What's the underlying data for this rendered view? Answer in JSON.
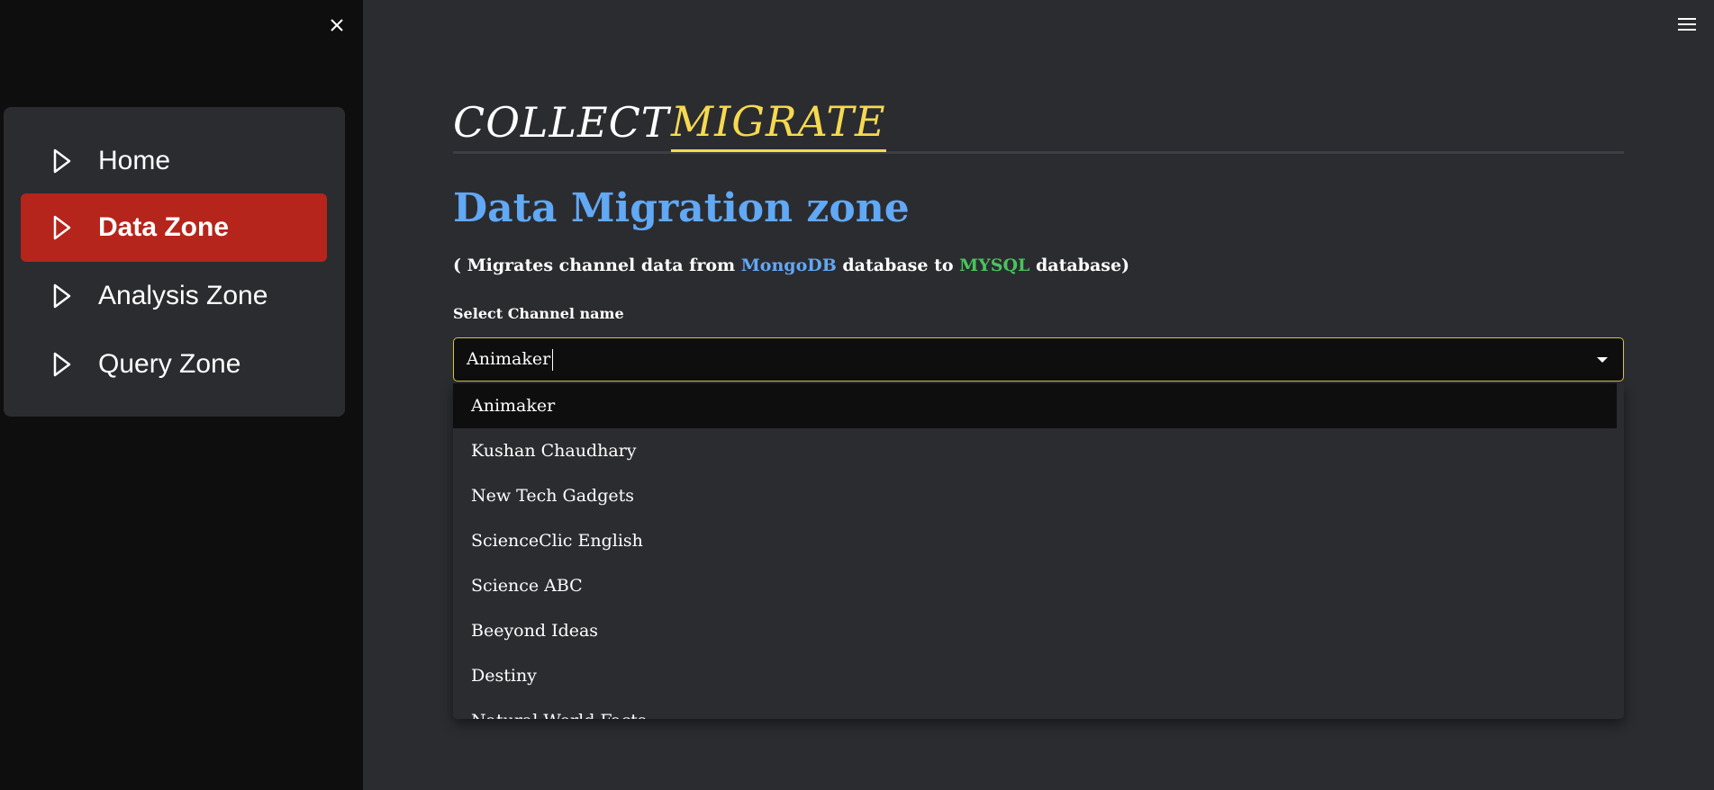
{
  "sidebar": {
    "nav": [
      {
        "label": "Home",
        "active": false
      },
      {
        "label": "Data Zone",
        "active": true
      },
      {
        "label": "Analysis Zone",
        "active": false
      },
      {
        "label": "Query Zone",
        "active": false
      }
    ]
  },
  "tabs": {
    "collect": "COLLECT",
    "migrate": "MIGRATE",
    "active": "MIGRATE"
  },
  "main": {
    "title": "Data Migration zone",
    "subtitle": {
      "prefix": "( Migrates channel data from ",
      "source_db": "MongoDB",
      "middle": " database to ",
      "target_db": "MYSQL",
      "suffix": " database)"
    },
    "select_label": "Select Channel name",
    "select_value": "Animaker",
    "options": [
      "Animaker",
      "Kushan Chaudhary",
      "New Tech Gadgets",
      "ScienceClic English",
      "Science ABC",
      "Beeyond Ideas",
      "Destiny",
      "Natural World Facts"
    ]
  },
  "colors": {
    "accent_red": "#b5251b",
    "tab_highlight": "#f5d94f",
    "title_blue": "#61a8f5",
    "mongodb_blue": "#61a8f5",
    "mysql_green": "#49c35d"
  },
  "icons": {
    "close": "close-icon",
    "menu": "hamburger-menu-icon",
    "nav": "play-triangle-icon",
    "dropdown": "caret-down-icon"
  }
}
